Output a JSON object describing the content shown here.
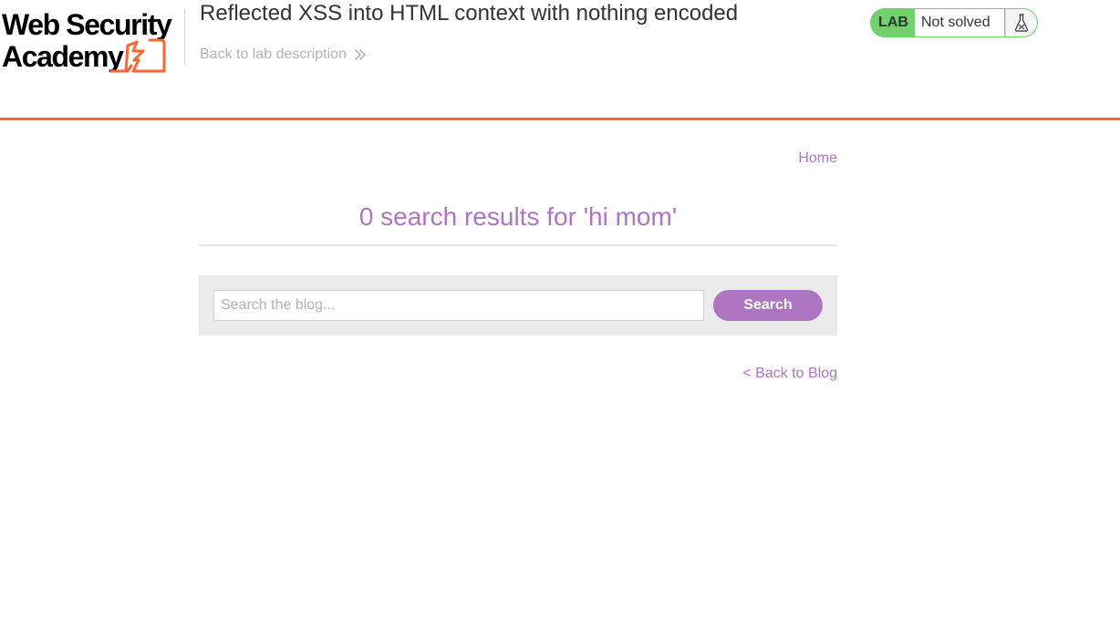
{
  "header": {
    "logo": {
      "line1": "Web Security",
      "line2": "Academy",
      "icon": "lightning-bolt-icon"
    },
    "lab_title": "Reflected XSS into HTML context with nothing encoded",
    "back_link_label": "Back to lab description",
    "back_link_icon": "double-chevron-right-icon"
  },
  "lab_status": {
    "badge": "LAB",
    "status": "Not solved",
    "icon": "flask-icon"
  },
  "nav": {
    "home_label": "Home"
  },
  "results": {
    "heading": "0 search results for 'hi mom'"
  },
  "search": {
    "placeholder": "Search the blog...",
    "value": "",
    "button_label": "Search"
  },
  "footer_nav": {
    "back_to_blog_label": "< Back to Blog"
  },
  "colors": {
    "accent_orange": "#ff6633",
    "purple": "#ae75c3",
    "lab_green": "#70d16d",
    "text_dark": "#333332",
    "muted": "#b3b3b3"
  }
}
